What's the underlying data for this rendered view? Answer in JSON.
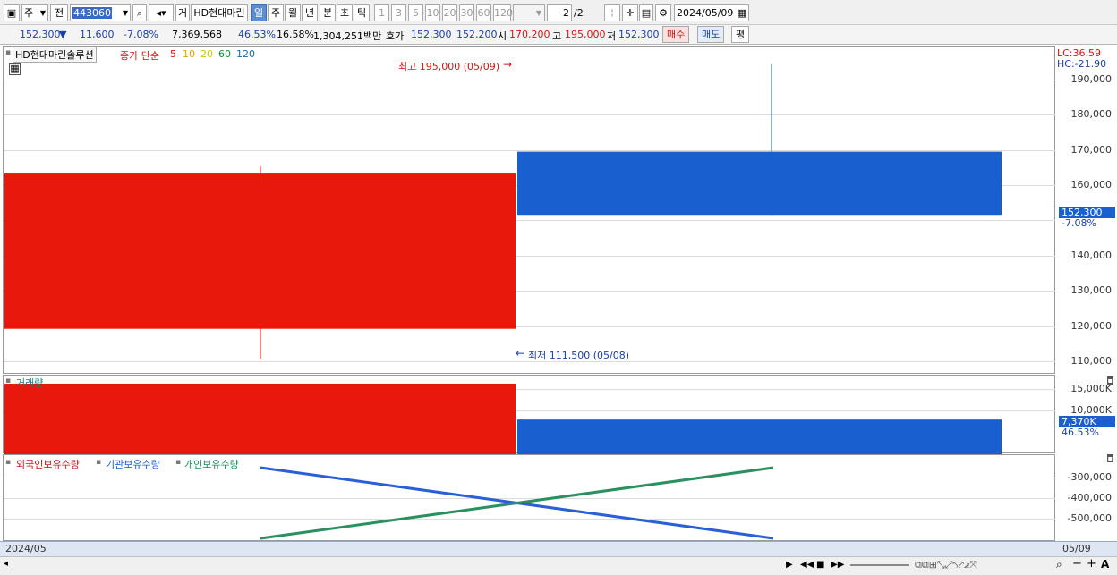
{
  "toolbar": {
    "market": "주",
    "prev": "전",
    "code": "443060",
    "trade_btn": "거",
    "stock_name": "HD현대마린",
    "periods": [
      "일",
      "주",
      "월",
      "년",
      "분",
      "초",
      "틱"
    ],
    "selected_period": "일",
    "intervals": [
      "1",
      "3",
      "5",
      "10",
      "20",
      "30",
      "60",
      "120"
    ],
    "page": "2",
    "page_total": "/2",
    "date": "2024/05/09"
  },
  "quote": {
    "price": "152,300",
    "arrow": "▼",
    "change": "11,600",
    "change_pct": "-7.08%",
    "volume": "7,369,568",
    "vol_ratio": "46.53%",
    "turnover": "16.58%",
    "amount": "1,304,251백만",
    "hoga_label": "호가",
    "ask": "152,300",
    "bid": "152,200",
    "open_label": "시",
    "open": "170,200",
    "high_label": "고",
    "high": "195,000",
    "low_label": "저",
    "low": "152,300",
    "buy_btn": "매수",
    "sell_btn": "매도",
    "eval_btn": "평"
  },
  "price_panel": {
    "name": "HD현대마린솔루션",
    "ind_label": "종가 단순",
    "ma": [
      "5",
      "10",
      "20",
      "60",
      "120"
    ],
    "ma_colors": [
      "#d41414",
      "#e0a000",
      "#c8c800",
      "#1a8a3a",
      "#1a6aa8"
    ],
    "high_note": "최고 195,000 (05/09)",
    "low_note": "최저 111,500 (05/08)",
    "lc": "LC:36.59",
    "hc": "HC:-21.90",
    "yticks": [
      "190,000",
      "180,000",
      "170,000",
      "160,000",
      "140,000",
      "130,000",
      "120,000",
      "110,000"
    ],
    "cur_price": "152,300",
    "cur_pct": "-7.08%"
  },
  "volume_panel": {
    "title": "거래량",
    "yticks": [
      "15,000K",
      "10,000K"
    ],
    "cur": "7,370K",
    "pct": "46.53%"
  },
  "holding_panel": {
    "legend": [
      "외국인보유수량",
      "기관보유수량",
      "개인보유수량"
    ],
    "legend_colors": [
      "#c01818",
      "#1a5fd0",
      "#168a5a"
    ],
    "yticks": [
      "-300,000",
      "-400,000",
      "-500,000"
    ]
  },
  "xaxis": {
    "left": "2024/05",
    "right": "05/09"
  },
  "chart_data": {
    "type": "candlestick",
    "categories": [
      "05/08",
      "05/09"
    ],
    "candles": [
      {
        "date": "05/08",
        "open": 120000,
        "high": 166000,
        "low": 111500,
        "close": 164000
      },
      {
        "date": "05/09",
        "open": 170200,
        "high": 195000,
        "low": 152300,
        "close": 152300
      }
    ],
    "volume_k": [
      15000,
      7370
    ],
    "ylim": [
      107000,
      200000
    ]
  }
}
